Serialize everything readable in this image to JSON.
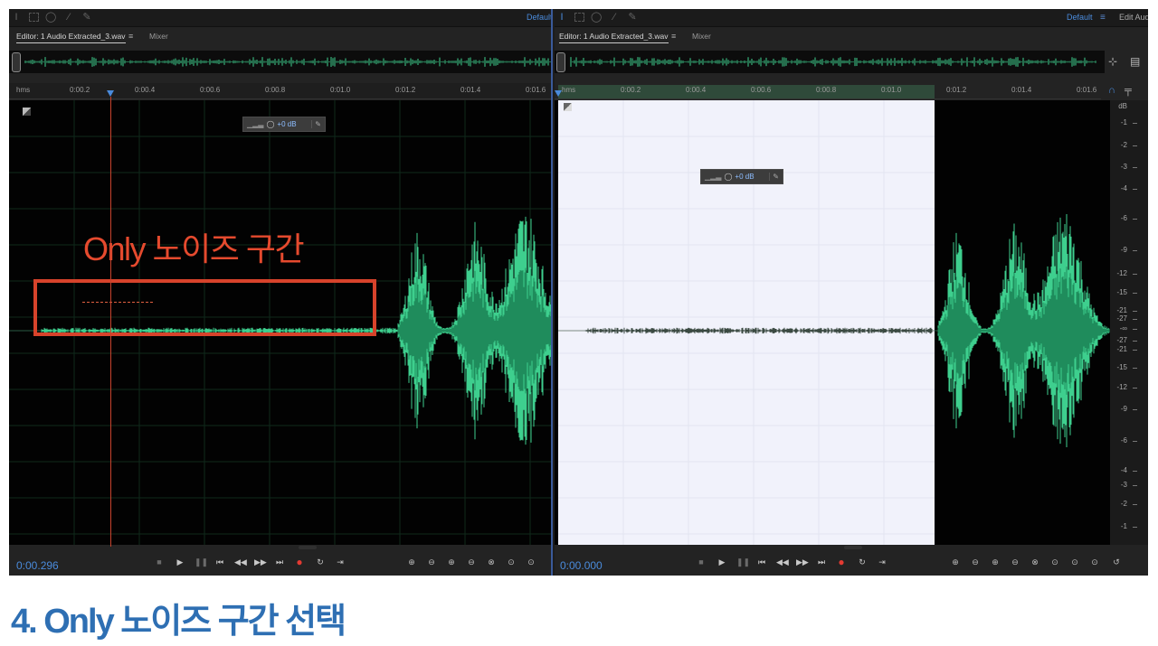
{
  "left": {
    "toolbar": {
      "workspace": "Default",
      "menu": "≡"
    },
    "tab": {
      "label": "Editor: 1 Audio Extracted_3.wav",
      "menu": "≡",
      "mixer": "Mixer"
    },
    "ruler": {
      "unit": "hms",
      "ticks": [
        "0:00.2",
        "0:00.4",
        "0:00.6",
        "0:00.8",
        "0:01.0",
        "0:01.2",
        "0:01.4",
        "0:01.6"
      ]
    },
    "hud": {
      "gain": "+0 dB"
    },
    "annotation": {
      "title": "Only 노이즈 구간"
    },
    "timecode": "0:00.296"
  },
  "right": {
    "toolbar": {
      "workspace": "Default",
      "menu": "≡",
      "edit_label": "Edit Audi"
    },
    "tab": {
      "label": "Editor: 1 Audio Extracted_3.wav",
      "menu": "≡",
      "mixer": "Mixer"
    },
    "ruler": {
      "unit": "hms",
      "ticks": [
        "0:00.2",
        "0:00.4",
        "0:00.6",
        "0:00.8",
        "0:01.0",
        "0:01.2",
        "0:01.4",
        "0:01.6"
      ]
    },
    "hud": {
      "gain": "+0 dB"
    },
    "db_scale": {
      "unit": "dB",
      "labels": [
        "-1",
        "-2",
        "-3",
        "-4",
        "-6",
        "-9",
        "-12",
        "-15",
        "-21",
        "-27",
        "-∞",
        "-27",
        "-21",
        "-15",
        "-12",
        "-9",
        "-6",
        "-4",
        "-3",
        "-2",
        "-1"
      ]
    },
    "timecode": "0:00.000"
  },
  "icons": {
    "time_select": "I-beam-icon",
    "marquee": "marquee-icon",
    "lasso": "lasso-icon",
    "brush": "brush-icon",
    "healing": "spot-healing-icon",
    "play": "▶",
    "stop": "■",
    "pause": "❚❚",
    "to_start": "⏮",
    "rewind": "◀◀",
    "forward": "▶▶",
    "to_end": "⏭",
    "record": "●",
    "skip": "⇥",
    "loop": "↻"
  },
  "caption": "4. Only 노이즈 구간 선택",
  "colors": {
    "waveform": "#3ecf8e",
    "selection": "#f1f2fb",
    "annotation": "#e54a2e",
    "caption": "#2e6fb3",
    "timecode": "#4a8bdc"
  }
}
